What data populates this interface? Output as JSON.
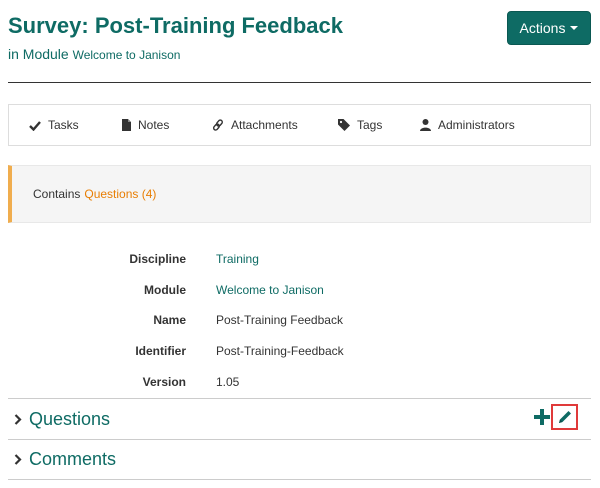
{
  "header": {
    "title": "Survey: Post-Training Feedback",
    "in_module_prefix": "in Module",
    "module_link": "Welcome to Janison",
    "actions_label": "Actions"
  },
  "tabs": [
    {
      "label": "Tasks",
      "icon": "check-icon"
    },
    {
      "label": "Notes",
      "icon": "file-icon"
    },
    {
      "label": "Attachments",
      "icon": "link-icon"
    },
    {
      "label": "Tags",
      "icon": "tag-icon"
    },
    {
      "label": "Administrators",
      "icon": "user-icon"
    }
  ],
  "contains": {
    "prefix": "Contains",
    "link": "Questions (4)",
    "accent": "#f0ad4e"
  },
  "details": [
    {
      "label": "Discipline",
      "value": "Training",
      "is_link": true
    },
    {
      "label": "Module",
      "value": "Welcome to Janison",
      "is_link": true
    },
    {
      "label": "Name",
      "value": "Post-Training Feedback",
      "is_link": false
    },
    {
      "label": "Identifier",
      "value": "Post-Training-Feedback",
      "is_link": false
    },
    {
      "label": "Version",
      "value": "1.05",
      "is_link": false
    }
  ],
  "sections": [
    {
      "title": "Questions",
      "icon": "chevron-right-icon"
    },
    {
      "title": "Comments",
      "icon": "chevron-right-icon"
    }
  ],
  "colors": {
    "brand": "#0e6b64",
    "highlight": "#e03a3a"
  }
}
